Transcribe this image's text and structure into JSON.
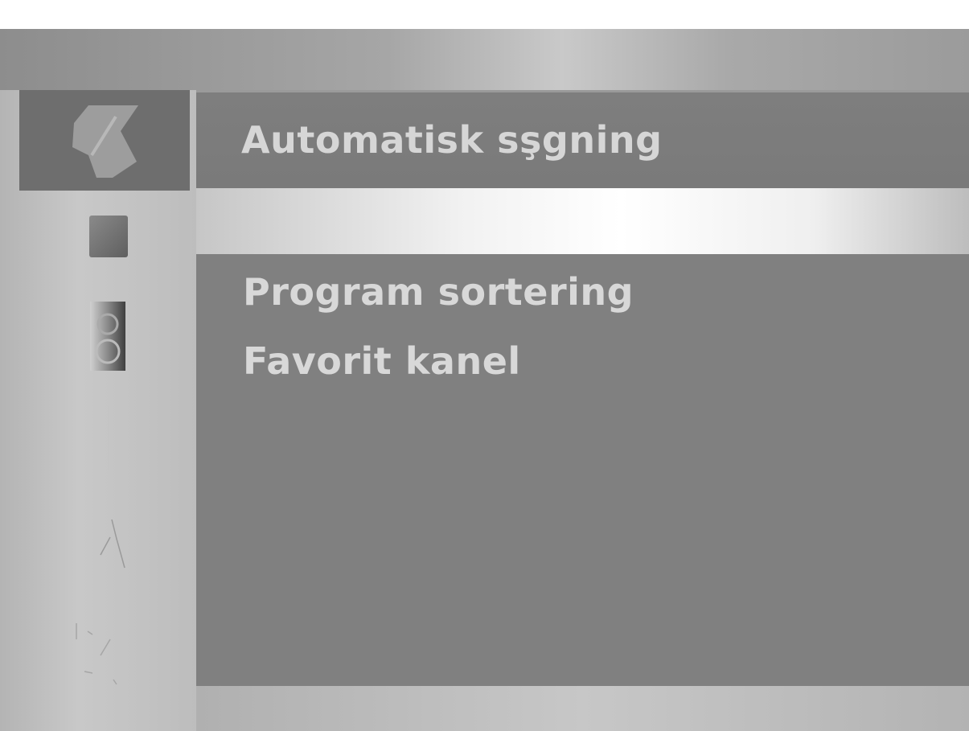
{
  "sidebar": {
    "items": [
      {
        "icon": "satellite-dish-icon",
        "selected": true
      },
      {
        "icon": "tv-screen-icon",
        "selected": false
      },
      {
        "icon": "lock-icon",
        "selected": false
      },
      {
        "icon": "faint-icon",
        "selected": false
      },
      {
        "icon": "faint-icon",
        "selected": false
      },
      {
        "icon": "faint-icon",
        "selected": false
      }
    ]
  },
  "header": {
    "title": "Automatisk sşgning"
  },
  "menu": {
    "items": [
      {
        "label": "Program sortering"
      },
      {
        "label": "Favorit kanel"
      }
    ]
  },
  "colors": {
    "selected_bg": "#6e6e6e",
    "panel_bg": "#808080",
    "text": "#d8d8d8"
  }
}
